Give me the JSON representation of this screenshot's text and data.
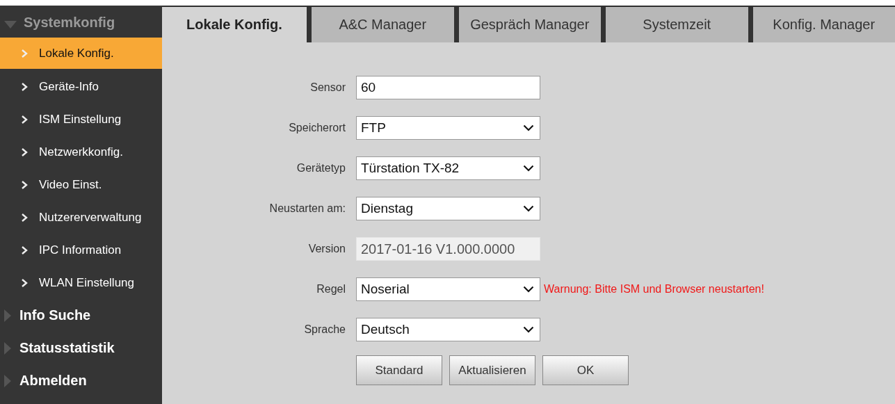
{
  "sidebar": {
    "groups": [
      {
        "label": "Systemkonfig",
        "expanded": true,
        "items": [
          {
            "label": "Lokale Konfig.",
            "selected": true
          },
          {
            "label": "Geräte-Info",
            "selected": false
          },
          {
            "label": "ISM Einstellung",
            "selected": false
          },
          {
            "label": "Netzwerkkonfig.",
            "selected": false
          },
          {
            "label": "Video Einst.",
            "selected": false
          },
          {
            "label": "Nutzererverwaltung",
            "selected": false
          },
          {
            "label": "IPC Information",
            "selected": false
          },
          {
            "label": "WLAN Einstellung",
            "selected": false
          }
        ]
      },
      {
        "label": "Info Suche",
        "expanded": false
      },
      {
        "label": "Statusstatistik",
        "expanded": false
      },
      {
        "label": "Abmelden",
        "expanded": false
      }
    ]
  },
  "tabs": [
    {
      "label": "Lokale Konfig.",
      "selected": true
    },
    {
      "label": "A&C Manager",
      "selected": false
    },
    {
      "label": "Gespräch Manager",
      "selected": false
    },
    {
      "label": "Systemzeit",
      "selected": false
    },
    {
      "label": "Konfig. Manager",
      "selected": false
    }
  ],
  "form": {
    "fields": [
      {
        "label": "Sensor",
        "kind": "text",
        "value": "60"
      },
      {
        "label": "Speicherort",
        "kind": "select",
        "value": "FTP"
      },
      {
        "label": "Gerätetyp",
        "kind": "select",
        "value": "Türstation TX-82"
      },
      {
        "label": "Neustarten am:",
        "kind": "select",
        "value": "Dienstag"
      },
      {
        "label": "Version",
        "kind": "readonly",
        "value": "2017-01-16 V1.000.0000"
      },
      {
        "label": "Regel",
        "kind": "select",
        "value": "Noserial",
        "warning": "Warnung: Bitte ISM und Browser neustarten!"
      },
      {
        "label": "Sprache",
        "kind": "select",
        "value": "Deutsch"
      }
    ],
    "buttons": [
      "Standard",
      "Aktualisieren",
      "OK"
    ]
  }
}
